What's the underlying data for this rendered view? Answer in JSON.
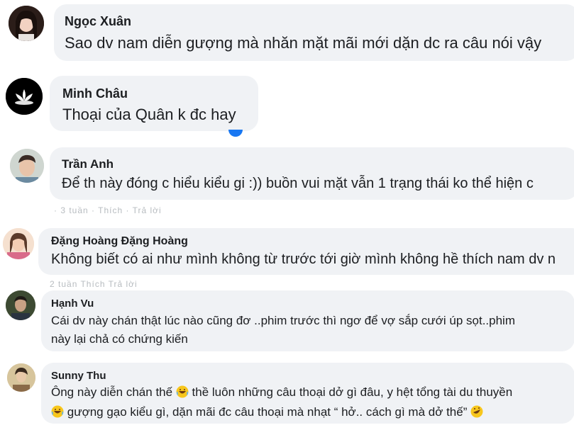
{
  "comments": [
    {
      "name": "Ngọc Xuân",
      "text": "Sao dv nam diễn gượng mà nhăn mặt mãi mới dặn dc ra câu nói vậy",
      "avatar": "avatar-girl"
    },
    {
      "name": "Minh Châu",
      "text": "Thoại của Quân k đc hay",
      "avatar": "avatar-lotus"
    },
    {
      "name": "Trần Anh",
      "text": "Để th này đóng c hiểu kiểu gi :)) buồn vui mặt vẫn 1 trạng thái ko thể hiện c",
      "avatar": "avatar-man"
    },
    {
      "name": "Đặng Hoàng Đặng Hoàng",
      "text": "Không biết có ai như mình không từ trước tới giờ mình không hề thích nam dv n",
      "avatar": "avatar-woman"
    },
    {
      "name": "Hạnh Vu",
      "text_line1": "Cái dv này chán thật lúc nào cũng đơ ..phim trước thì ngơ để vợ sắp cưới úp sọt..phim",
      "text_line2": "này lại chả có chứng kiến",
      "avatar": "avatar-person"
    },
    {
      "name": "Sunny Thu",
      "text_line1_a": "Ông này diễn chán thế",
      "text_line1_b": "thề luôn những câu thoại dở gì đâu, y hệt tổng tài du thuyền",
      "text_line2_a": "gượng gạo kiểu gì, dặn mãi đc câu thoại mà nhạt “ hở.. cách gì mà dở thế”",
      "avatar": "avatar-person2"
    }
  ],
  "faint_rows": [
    "· 3 tuần    · Thích    · Trả lời",
    "2 tuần    Thích    Trả lời"
  ],
  "colors": {
    "bubble": "#f0f2f5",
    "text": "#1c1e21",
    "meta": "#65676b"
  }
}
